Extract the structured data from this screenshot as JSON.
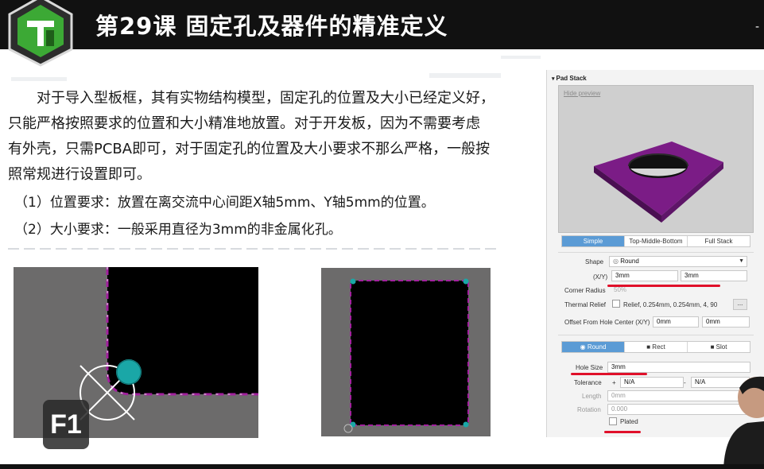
{
  "header": {
    "title": "第29课 固定孔及器件的精准定义",
    "corner": "-"
  },
  "body": {
    "paragraph": [
      "对于导入型板框，其有实物结构模型，固定孔的位置及大小已经定义好，",
      "只能严格按照要求的位置和大小精准地放置。对于开发板，因为不需要考虑",
      "有外壳，只需PCBA即可，对于固定孔的位置及大小要求不那么严格，一般按",
      "照常规进行设置即可。"
    ],
    "requirements": [
      "（1）位置要求：放置在离交流中心间距X轴5mm、Y轴5mm的位置。",
      "（2）大小要求：一般采用直径为3mm的非金属化孔。"
    ]
  },
  "badge": "F1",
  "pad_stack": {
    "header": "Pad Stack",
    "hide_preview": "Hide preview",
    "mode_tabs": [
      "Simple",
      "Top-Middle-Bottom",
      "Full Stack"
    ],
    "active_mode": "Simple",
    "shape_label": "Shape",
    "shape_value": "Round",
    "xy_label": "(X/Y)",
    "x_value": "3mm",
    "y_value": "3mm",
    "corner_radius_label": "Corner Radius",
    "corner_radius_value": "50%",
    "thermal_relief_label": "Thermal Relief",
    "thermal_relief_value": "Relief, 0.254mm, 0.254mm, 4, 90",
    "thermal_button": "...",
    "offset_label": "Offset From Hole Center (X/Y)",
    "offset_x": "0mm",
    "offset_y": "0mm",
    "hole_tabs": [
      "Round",
      "Rect",
      "Slot"
    ],
    "active_hole": "Round",
    "hole_size_label": "Hole Size",
    "hole_size_value": "3mm",
    "tolerance_label": "Tolerance",
    "tolerance_plus_sign": "+",
    "tolerance_plus": "N/A",
    "tolerance_minus_sign": "-",
    "tolerance_minus": "N/A",
    "length_label": "Length",
    "length_value": "0mm",
    "rotation_label": "Rotation",
    "rotation_value": "0.000",
    "plated_label": "Plated",
    "plated_checked": false,
    "colors": {
      "accent": "#5b9bd5",
      "pad_purple": "#7b1c86",
      "annotation_red": "#e0102a",
      "pad_teal": "#1aa7a7"
    }
  }
}
